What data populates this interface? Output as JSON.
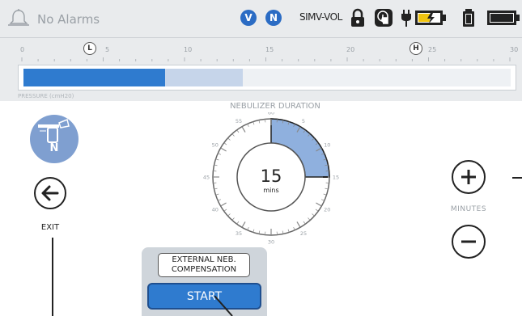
{
  "topbar": {
    "alarm_text": "No Alarms",
    "badge_v": "V",
    "badge_n": "N",
    "mode": "SIMV-VOL",
    "icons": [
      "bell-icon",
      "lock-icon",
      "touch-lock-icon",
      "plug-icon",
      "battery-charging-icon",
      "battery-small-icon",
      "battery-full-icon"
    ]
  },
  "pressure_scale": {
    "ticks": [
      "0",
      "5",
      "10",
      "15",
      "20",
      "25",
      "30"
    ],
    "low_marker": "L",
    "high_marker": "H",
    "label": "PRESSURE (cmH20)",
    "fill_primary_fraction": 0.29,
    "fill_secondary_fraction": 0.16
  },
  "nebulizer": {
    "icon_letter": "N",
    "exit_label": "EXIT",
    "title": "NEBULIZER DURATION",
    "value": "15",
    "unit": "mins",
    "dial_labels": [
      "60",
      "5",
      "10",
      "15",
      "20",
      "25",
      "30",
      "35",
      "40",
      "45",
      "50",
      "55"
    ],
    "fraction": 0.25,
    "minutes_label": "MINUTES",
    "ext_label_line1": "EXTERNAL NEB.",
    "ext_label_line2": "COMPENSATION",
    "start_label": "START"
  },
  "colors": {
    "accent": "#2f7bcf",
    "dial_fill": "#8fb0de",
    "neb_icon_bg": "#7f9fd0"
  }
}
